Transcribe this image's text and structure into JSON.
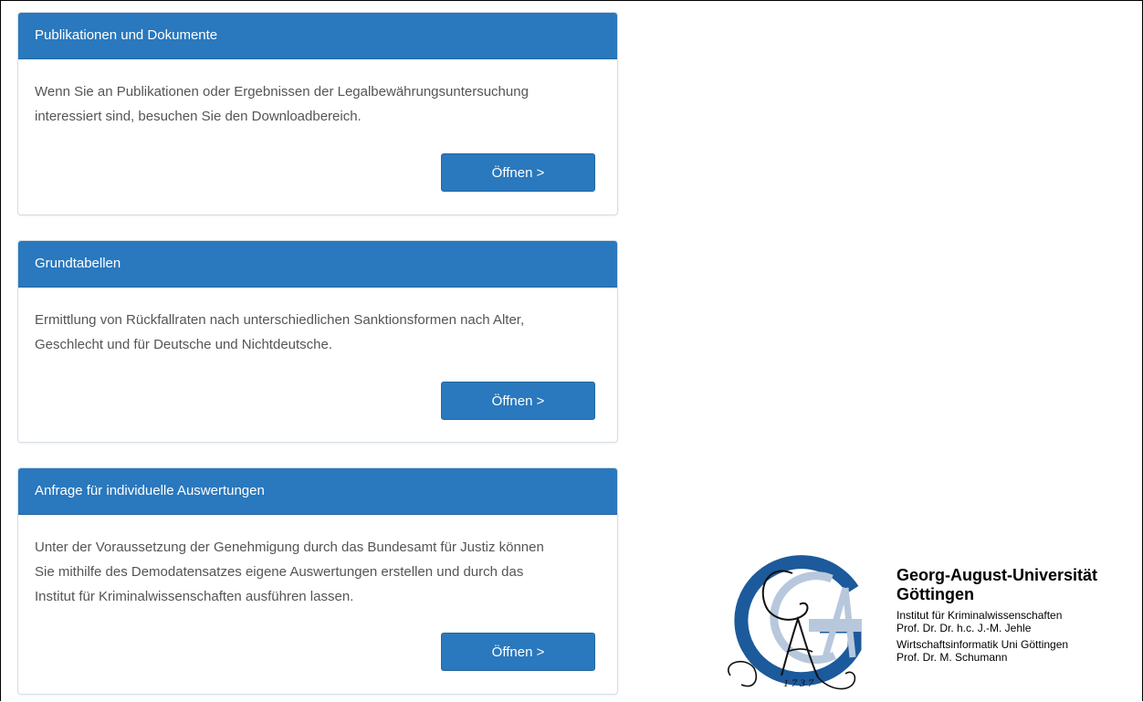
{
  "panels": [
    {
      "title": "Publikationen und Dokumente",
      "text_lines": [
        "Wenn Sie an Publikationen oder Ergebnissen der Legalbewährungsuntersuchung",
        "interessiert sind, besuchen Sie den Downloadbereich."
      ],
      "button_label": "Öffnen >"
    },
    {
      "title": "Grundtabellen",
      "text_lines": [
        "Ermittlung von Rückfallraten nach unterschiedlichen Sanktionsformen nach Alter,",
        "Geschlecht und für Deutsche und Nichtdeutsche."
      ],
      "button_label": "Öffnen >"
    },
    {
      "title": "Anfrage für individuelle Auswertungen",
      "text_lines": [
        "Unter der Voraussetzung der Genehmigung durch das Bundesamt für Justiz können",
        "Sie mithilfe des Demodatensatzes eigene Auswertungen erstellen und durch das",
        "Institut für Kriminalwissenschaften ausführen lassen."
      ],
      "button_label": "Öffnen >"
    }
  ],
  "logo": {
    "icon": "georg-august-university-seal",
    "year": "1 7 3 7",
    "university_name_line1": "Georg-August-Universität",
    "university_name_line2": "Göttingen",
    "info_lines": [
      "Institut für Kriminalwissenschaften",
      "Prof. Dr. Dr. h.c. J.-M. Jehle",
      "Wirtschaftsinformatik Uni Göttingen",
      "Prof. Dr. M. Schumann"
    ],
    "colors": {
      "dark_blue": "#1c5a9c",
      "light_blue": "#b8c8dc"
    }
  },
  "colors": {
    "panel_header": "#2a78bd",
    "button": "#2a78bd",
    "body_text": "#555555"
  }
}
